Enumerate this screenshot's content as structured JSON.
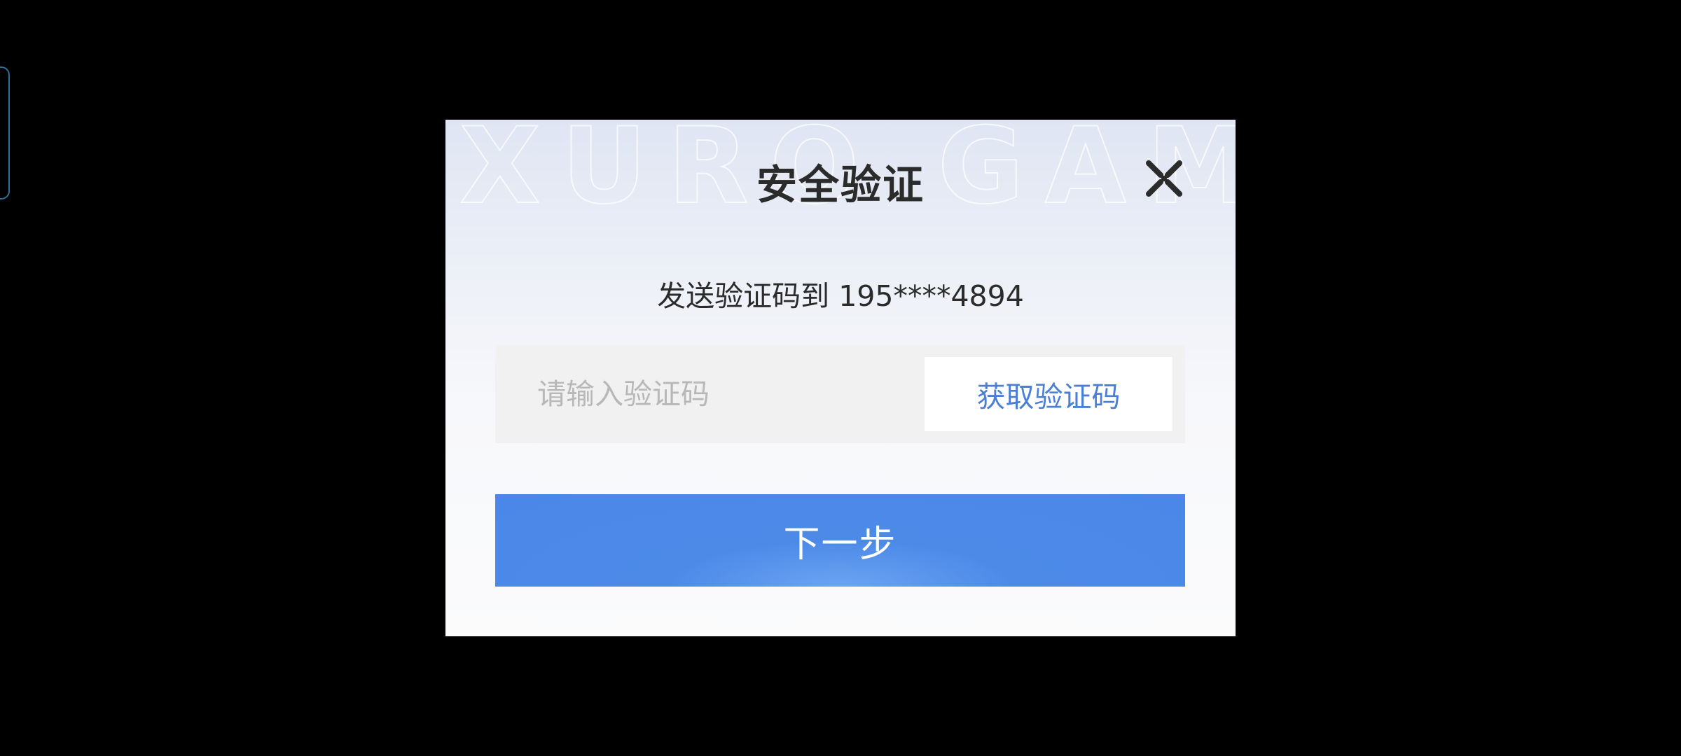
{
  "dialog": {
    "title": "安全验证",
    "watermark_text": "XURO GAMES",
    "subtitle": "发送验证码到 195****4894",
    "code_input": {
      "value": "",
      "placeholder": "请输入验证码"
    },
    "get_code_label": "获取验证码",
    "next_label": "下一步",
    "close_icon": "close-icon"
  },
  "colors": {
    "primary": "#4a87e8",
    "link": "#4a7fd4",
    "title_text": "#2b2b2b",
    "placeholder": "#b8b8b8",
    "backdrop": "#000000"
  }
}
